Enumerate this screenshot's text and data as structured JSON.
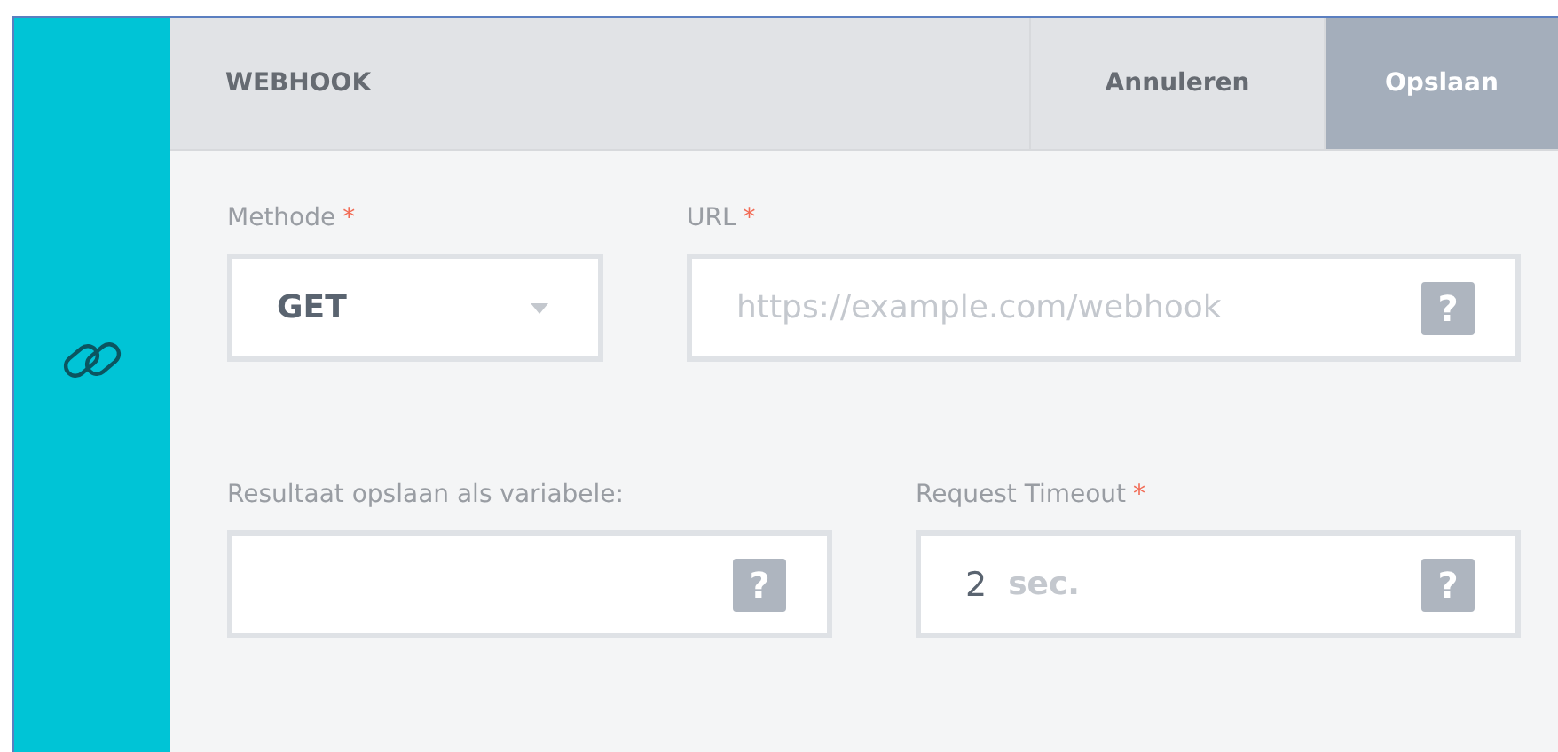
{
  "header": {
    "title": "WEBHOOK",
    "buttons": [
      {
        "label": "Annuleren",
        "kind": "secondary"
      },
      {
        "label": "Opslaan",
        "kind": "primary"
      }
    ]
  },
  "required_mark": "*",
  "rows": [
    {
      "fields": [
        {
          "label": "Methode",
          "required": true,
          "kind": "select",
          "value": "GET"
        },
        {
          "label": "URL",
          "required": true,
          "kind": "text",
          "placeholder": "https://example.com/webhook",
          "help": "?"
        }
      ]
    },
    {
      "fields": [
        {
          "label": "Resultaat opslaan als variabele:",
          "required": false,
          "kind": "text",
          "help": "?"
        },
        {
          "label": "Request Timeout",
          "required": true,
          "kind": "number",
          "value": "2",
          "suffix": "sec.",
          "help": "?"
        }
      ]
    }
  ]
}
